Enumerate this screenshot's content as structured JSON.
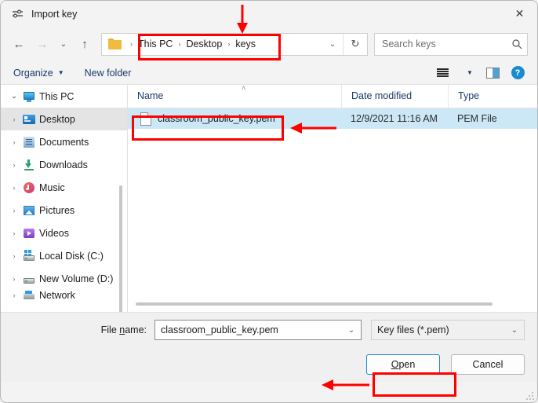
{
  "window": {
    "title": "Import key",
    "title_icon": "sliders-icon",
    "close_label": "✕"
  },
  "nav": {
    "back_icon": "←",
    "forward_icon": "→",
    "recent_icon": "⌄",
    "up_icon": "↑",
    "refresh_icon": "↻",
    "breadcrumb": [
      "This PC",
      "Desktop",
      "keys"
    ],
    "breadcrumb_sep": "›",
    "dropdown_icon": "⌄"
  },
  "search": {
    "placeholder": "Search keys",
    "icon": "search-icon"
  },
  "toolbar": {
    "organize_label": "Organize",
    "organize_caret": "▼",
    "new_folder_label": "New folder",
    "view_caret": "▼",
    "help_label": "?"
  },
  "sidebar": {
    "items": [
      {
        "label": "This PC",
        "icon": "pc-icon",
        "chevron": "⌄",
        "expanded": true,
        "selected": false,
        "indent": 0
      },
      {
        "label": "Desktop",
        "icon": "desktop-icon",
        "chevron": "›",
        "expanded": false,
        "selected": true,
        "indent": 1
      },
      {
        "label": "Documents",
        "icon": "documents-icon",
        "chevron": "›",
        "expanded": false,
        "selected": false,
        "indent": 1
      },
      {
        "label": "Downloads",
        "icon": "downloads-icon",
        "chevron": "›",
        "expanded": false,
        "selected": false,
        "indent": 1
      },
      {
        "label": "Music",
        "icon": "music-icon",
        "chevron": "›",
        "expanded": false,
        "selected": false,
        "indent": 1
      },
      {
        "label": "Pictures",
        "icon": "pictures-icon",
        "chevron": "›",
        "expanded": false,
        "selected": false,
        "indent": 1
      },
      {
        "label": "Videos",
        "icon": "videos-icon",
        "chevron": "›",
        "expanded": false,
        "selected": false,
        "indent": 1
      },
      {
        "label": "Local Disk (C:)",
        "icon": "disk-icon",
        "chevron": "›",
        "expanded": false,
        "selected": false,
        "indent": 1
      },
      {
        "label": "New Volume (D:)",
        "icon": "disk-icon",
        "chevron": "›",
        "expanded": false,
        "selected": false,
        "indent": 1
      },
      {
        "label": "Network",
        "icon": "network-icon",
        "chevron": "›",
        "expanded": false,
        "selected": false,
        "indent": 0
      }
    ]
  },
  "filelist": {
    "columns": [
      "Name",
      "Date modified",
      "Type"
    ],
    "sort_caret": "˄",
    "rows": [
      {
        "name": "classroom_public_key.pem",
        "date_modified": "12/9/2021 11:16 AM",
        "type": "PEM File",
        "icon": "file-icon",
        "selected": true
      }
    ]
  },
  "footer": {
    "file_name_label_pre": "File ",
    "file_name_label_key": "n",
    "file_name_label_post": "ame:",
    "file_name_value": "classroom_public_key.pem",
    "file_name_caret": "⌄",
    "filter_value": "Key files (*.pem)",
    "filter_caret": "⌄",
    "open_label_key": "O",
    "open_label_rest": "pen",
    "cancel_label": "Cancel"
  },
  "annotations": {
    "accent_color": "#ff0000",
    "marks": [
      "breadcrumb-highlight-box",
      "breadcrumb-down-arrow",
      "file-row-highlight-box",
      "file-row-left-arrow",
      "open-button-highlight-box",
      "open-button-left-arrow"
    ]
  }
}
